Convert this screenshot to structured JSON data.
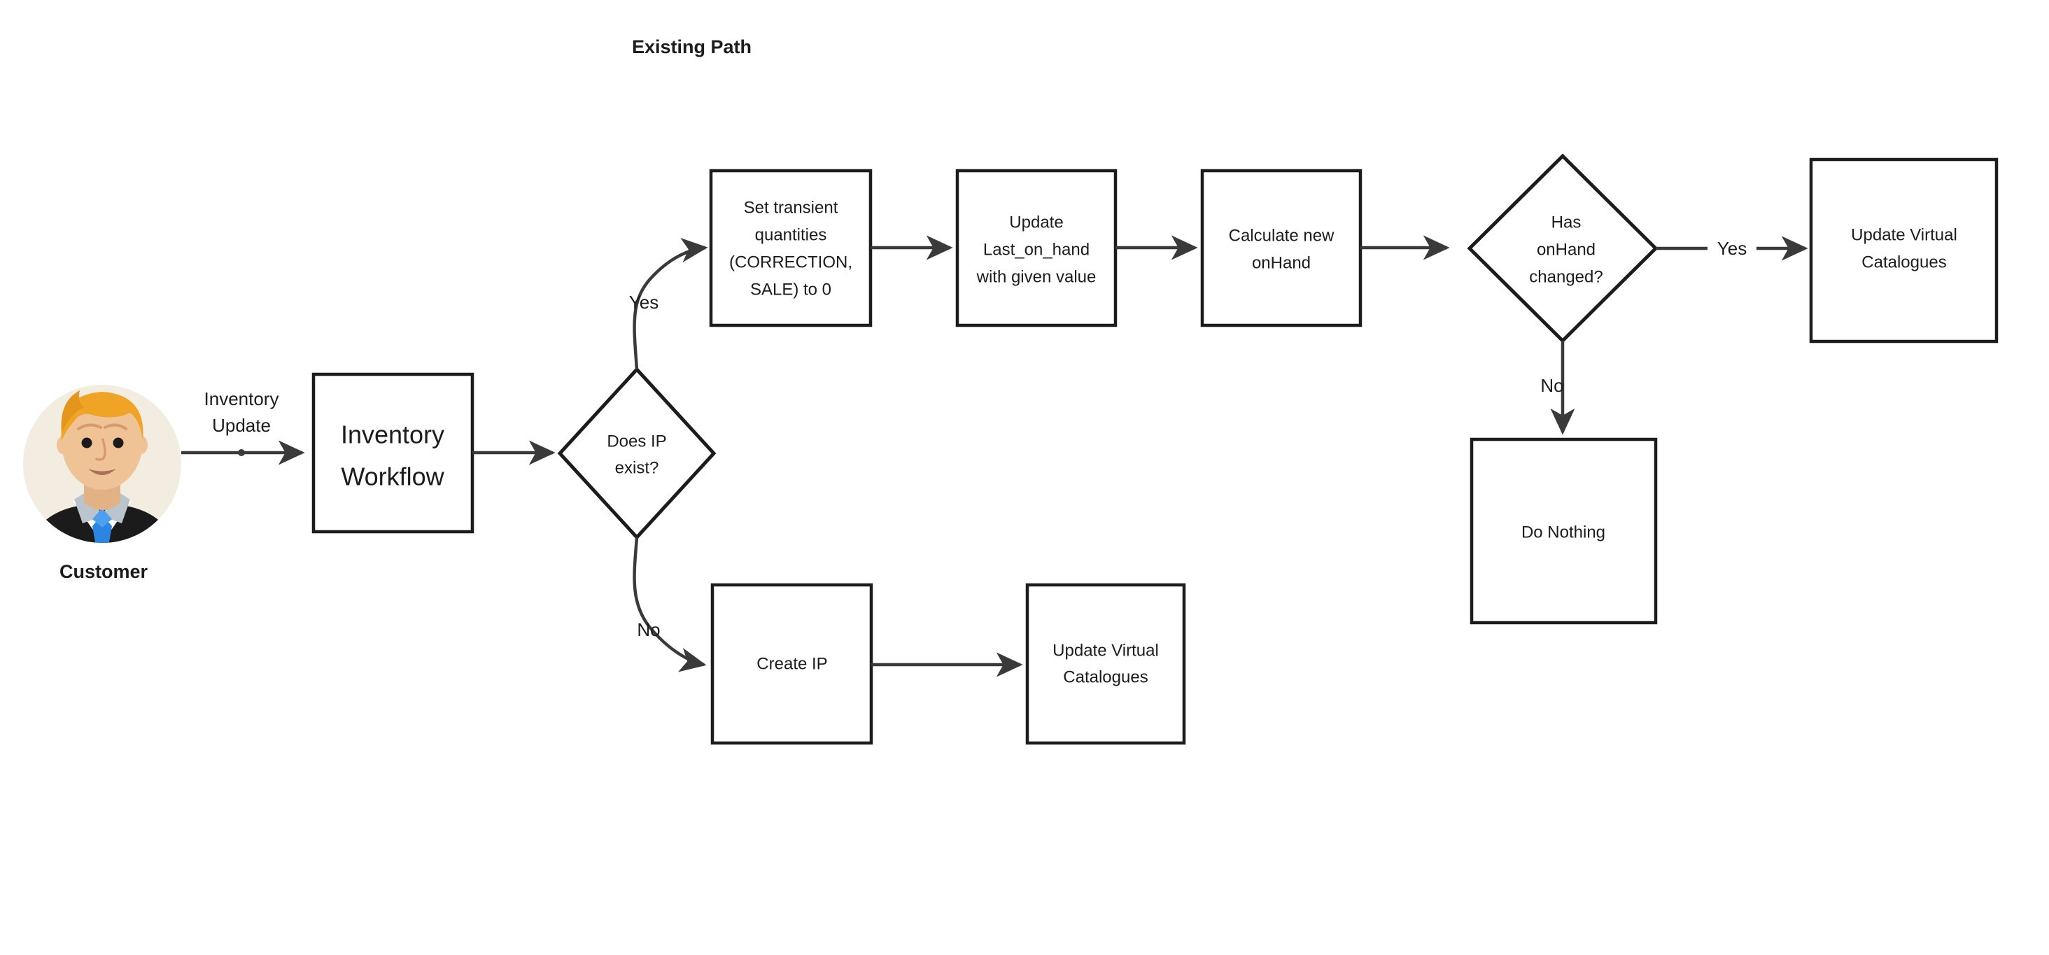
{
  "title": "Existing Path",
  "actor": {
    "name": "Customer",
    "avatar_icon": "businessman-avatar-icon",
    "colors": {
      "circle_bg": "#f2ece1",
      "hair": "#efa426",
      "skin": "#f0c396",
      "suit": "#1b1b1b",
      "shirt": "#ffffff",
      "tie": "#2a86e0",
      "collar": "#b9c4cc",
      "eyes": "#1b1b1b",
      "mouth": "#a9705a"
    }
  },
  "nodes": {
    "inventory_workflow": {
      "label": "Inventory Workflow",
      "lines": [
        "Inventory",
        "Workflow"
      ],
      "shape": "rect"
    },
    "does_ip_exist": {
      "label": "Does IP exist?",
      "lines": [
        "Does IP",
        "exist?"
      ],
      "shape": "diamond"
    },
    "set_transient": {
      "label": "Set transient quantities (CORRECTION, SALE) to 0",
      "lines": [
        "Set transient",
        "quantities",
        "(CORRECTION,",
        "SALE) to 0"
      ],
      "shape": "rect"
    },
    "update_last_on_hand": {
      "label": "Update Last_on_hand with given value",
      "lines": [
        "Update",
        "Last_on_hand",
        "with given value"
      ],
      "shape": "rect"
    },
    "calculate_new_onhand": {
      "label": "Calculate new onHand",
      "lines": [
        "Calculate new",
        "onHand"
      ],
      "shape": "rect"
    },
    "has_onhand_changed": {
      "label": "Has onHand changed?",
      "lines": [
        "Has",
        "onHand",
        "changed?"
      ],
      "shape": "diamond"
    },
    "update_virtual_catalogues_top": {
      "label": "Update Virtual Catalogues",
      "lines": [
        "Update Virtual",
        "Catalogues"
      ],
      "shape": "rect"
    },
    "do_nothing": {
      "label": "Do Nothing",
      "lines": [
        "Do Nothing"
      ],
      "shape": "rect"
    },
    "create_ip": {
      "label": "Create IP",
      "lines": [
        "Create IP"
      ],
      "shape": "rect"
    },
    "update_virtual_catalogues_bottom": {
      "label": "Update Virtual Catalogues",
      "lines": [
        "Update Virtual",
        "Catalogues"
      ],
      "shape": "rect"
    }
  },
  "edge_labels": {
    "inventory_update": {
      "lines": [
        "Inventory",
        "Update"
      ]
    },
    "ip_yes": "Yes",
    "ip_no": "No",
    "onhand_yes": "Yes",
    "onhand_no": "No"
  },
  "colors": {
    "stroke": "#1c1c1c",
    "edge": "#3a3a3a",
    "background": "#ffffff",
    "text": "#1c1c1c"
  }
}
